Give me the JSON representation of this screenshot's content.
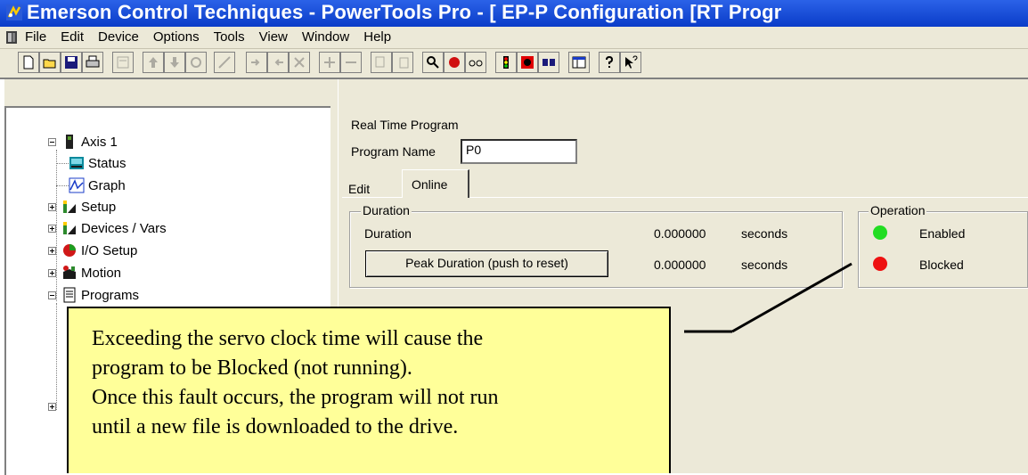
{
  "window": {
    "title": "Emerson Control Techniques - PowerTools Pro - [ EP-P Configuration  [RT Progr"
  },
  "menu": [
    "File",
    "Edit",
    "Device",
    "Options",
    "Tools",
    "View",
    "Window",
    "Help"
  ],
  "tree": {
    "root": "Axis 1",
    "items": [
      "Status",
      "Graph",
      "Setup",
      "Devices / Vars",
      "I/O Setup",
      "Motion",
      "Programs"
    ]
  },
  "detail": {
    "section_title": "Real Time Program",
    "program_name_label": "Program Name",
    "program_name_value": "P0",
    "tabs": [
      "Edit",
      "Online"
    ],
    "active_tab": "Online",
    "duration_group": {
      "title": "Duration",
      "rows": [
        {
          "label": "Duration",
          "value": "0.000000",
          "unit": "seconds"
        },
        {
          "label": "Peak Duration (push to reset)",
          "value": "0.000000",
          "unit": "seconds"
        }
      ]
    },
    "operation_group": {
      "title": "Operation",
      "items": [
        {
          "label": "Enabled",
          "color": "#22dd22"
        },
        {
          "label": "Blocked",
          "color": "#ee1111"
        }
      ]
    }
  },
  "callout": {
    "lines": [
      "Exceeding the servo clock time will cause the",
      "program to be Blocked (not running).",
      "Once this fault occurs, the program will not run",
      "until a new file is downloaded to the drive."
    ]
  }
}
